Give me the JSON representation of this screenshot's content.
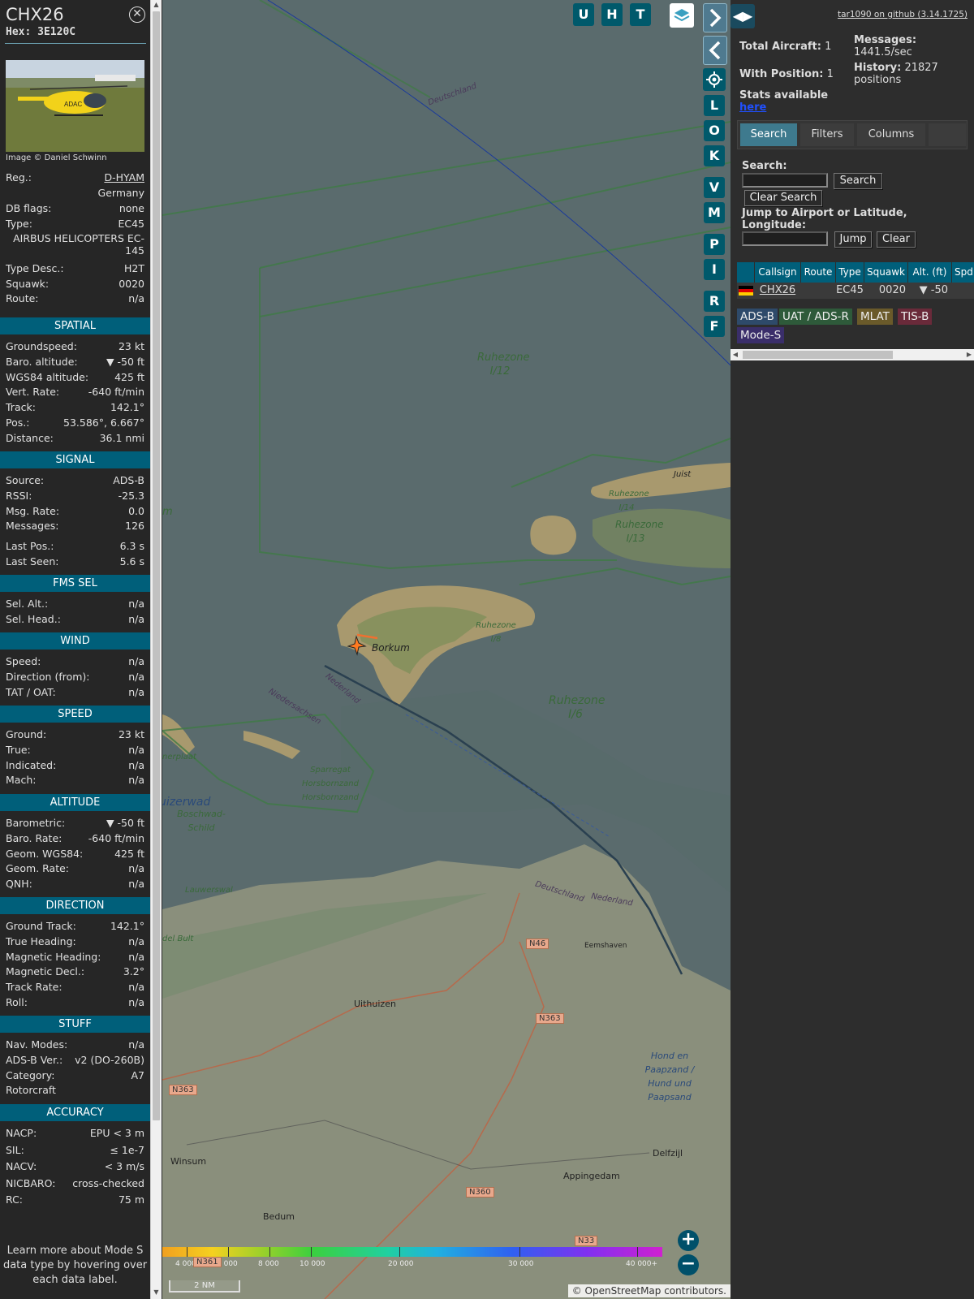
{
  "sidebar": {
    "callsign": "CHX26",
    "hex": "Hex: 3E120C",
    "photo_credit": "Image © Daniel Schwinn",
    "info_rows": [
      {
        "label": "Reg.:",
        "value": "D-HYAM"
      },
      {
        "label": "",
        "value": "Germany"
      },
      {
        "label": "DB flags:",
        "value": "none"
      },
      {
        "label": "Type:",
        "value": "EC45"
      },
      {
        "label": "",
        "value": "AIRBUS HELICOPTERS EC-145"
      },
      {
        "label": "Type Desc.:",
        "value": "H2T"
      },
      {
        "label": "Squawk:",
        "value": "0020"
      },
      {
        "label": "Route:",
        "value": "n/a"
      }
    ],
    "sections": [
      {
        "title": "SPATIAL",
        "rows": [
          {
            "label": "Groundspeed:",
            "value": "23 kt"
          },
          {
            "label": "Baro. altitude:",
            "value": "▼ -50 ft"
          },
          {
            "label": "WGS84 altitude:",
            "value": "425 ft"
          },
          {
            "label": "Vert. Rate:",
            "value": "-640 ft/min"
          },
          {
            "label": "Track:",
            "value": "142.1°"
          },
          {
            "label": "Pos.:",
            "value": "53.586°, 6.667°"
          },
          {
            "label": "Distance:",
            "value": "36.1 nmi"
          }
        ]
      },
      {
        "title": "SIGNAL",
        "rows": [
          {
            "label": "Source:",
            "value": "ADS-B"
          },
          {
            "label": "RSSI:",
            "value": "-25.3"
          },
          {
            "label": "Msg. Rate:",
            "value": "0.0"
          },
          {
            "label": "Messages:",
            "value": "126"
          },
          {
            "label": "Last Pos.:",
            "value": "6.3 s"
          },
          {
            "label": "Last Seen:",
            "value": "5.6 s"
          }
        ]
      },
      {
        "title": "FMS SEL",
        "rows": [
          {
            "label": "Sel. Alt.:",
            "value": "n/a"
          },
          {
            "label": "Sel. Head.:",
            "value": "n/a"
          }
        ]
      },
      {
        "title": "WIND",
        "rows": [
          {
            "label": "Speed:",
            "value": "n/a"
          },
          {
            "label": "Direction (from):",
            "value": "n/a"
          },
          {
            "label": "TAT / OAT:",
            "value": "n/a"
          }
        ]
      },
      {
        "title": "SPEED",
        "rows": [
          {
            "label": "Ground:",
            "value": "23 kt"
          },
          {
            "label": "True:",
            "value": "n/a"
          },
          {
            "label": "Indicated:",
            "value": "n/a"
          },
          {
            "label": "Mach:",
            "value": "n/a"
          }
        ]
      },
      {
        "title": "ALTITUDE",
        "rows": [
          {
            "label": "Barometric:",
            "value": "▼ -50 ft"
          },
          {
            "label": "Baro. Rate:",
            "value": "-640 ft/min"
          },
          {
            "label": "Geom. WGS84:",
            "value": "425 ft"
          },
          {
            "label": "Geom. Rate:",
            "value": "n/a"
          },
          {
            "label": "QNH:",
            "value": "n/a"
          }
        ]
      },
      {
        "title": "DIRECTION",
        "rows": [
          {
            "label": "Ground Track:",
            "value": "142.1°"
          },
          {
            "label": "True Heading:",
            "value": "n/a"
          },
          {
            "label": "Magnetic Heading:",
            "value": "n/a"
          },
          {
            "label": "Magnetic Decl.:",
            "value": "3.2°"
          },
          {
            "label": "Track Rate:",
            "value": "n/a"
          },
          {
            "label": "Roll:",
            "value": "n/a"
          }
        ]
      },
      {
        "title": "STUFF",
        "rows": [
          {
            "label": "Nav. Modes:",
            "value": "n/a"
          },
          {
            "label": "ADS-B Ver.:",
            "value": "v2 (DO-260B)"
          },
          {
            "label": "Category:",
            "value": "A7"
          },
          {
            "label": "Rotorcraft",
            "value": ""
          }
        ]
      },
      {
        "title": "ACCURACY",
        "rows": [
          {
            "label": "NACP:",
            "value": "EPU < 3 m"
          },
          {
            "label": "SIL:",
            "value": "≤ 1e-7"
          },
          {
            "label": "NACV:",
            "value": "< 3 m/s"
          },
          {
            "label": "NICBARO:",
            "value": "cross-checked"
          },
          {
            "label": "RC:",
            "value": "75 m"
          }
        ]
      }
    ],
    "footer": "Learn more about Mode S data type by hovering over each data label."
  },
  "map": {
    "layer_buttons": [
      "U",
      "H",
      "T"
    ],
    "side_buttons": [
      "L",
      "O",
      "K",
      "V",
      "M",
      "P",
      "I",
      "R",
      "F"
    ],
    "labels": {
      "deutschland1": "Deutschland",
      "ruhezone12": "Ruhezone I/12",
      "juist": "Juist",
      "ruhezone14": "Ruhezone I/14",
      "ruhezone13": "Ruhezone I/13",
      "ruhezone8": "Ruhezone I/8",
      "borkum": "Borkum",
      "ruhezone6": "Ruhezone I/6",
      "nederland1": "Nederland",
      "niedersachsen": "Niedersachsen",
      "sparregat": "Sparregat Horsbornzand Horsbornzand",
      "boschwad": "Boschwad-Schild",
      "uizerwad": "uizerwad",
      "lauwerswal": "Lauwerswal",
      "nerplaat": "nerplaat",
      "deutschland2": "Deutschland",
      "nederland2": "Nederland",
      "eemshaven": "Eemshaven",
      "uithuizen": "Uithuizen",
      "hond": "Hond en Paapzand / Hund und Paapsand",
      "delfzijl": "Delfzijl",
      "appingedam": "Appingedam",
      "winsum": "Winsum",
      "bedum": "Bedum",
      "m": "m",
      "delbult": "del Bult"
    },
    "roads": [
      "N46",
      "N363",
      "N363",
      "N360",
      "N33",
      "N361"
    ],
    "altitude_scale": [
      "4 000",
      "6 000",
      "8 000",
      "10 000",
      "20 000",
      "30 000",
      "40 000+"
    ],
    "scale_bar": "2 NM",
    "zoom_in": "+",
    "zoom_out": "−",
    "attribution": "© OpenStreetMap contributors."
  },
  "panel": {
    "github_link": "tar1090 on github (3.14.1725)",
    "total_aircraft_label": "Total Aircraft:",
    "total_aircraft": "1",
    "with_position_label": "With Position:",
    "with_position": "1",
    "messages_label": "Messages:",
    "messages_rate": "1441.5/sec",
    "history_label": "History:",
    "history_value": "21827",
    "history_unit": "positions",
    "stats_text": "Stats available",
    "stats_link": "here",
    "tabs": [
      "Search",
      "Filters",
      "Columns"
    ],
    "search_label": "Search:",
    "search_button": "Search",
    "clear_search_button": "Clear Search",
    "jump_label": "Jump to Airport or Latitude, Longitude:",
    "jump_button": "Jump",
    "clear_button": "Clear",
    "table": {
      "headers": [
        "Callsign",
        "Route",
        "Type",
        "Squawk",
        "Alt. (ft)",
        "Spd."
      ],
      "rows": [
        {
          "flag": "de",
          "callsign": "CHX26",
          "route": "",
          "type": "EC45",
          "squawk": "0020",
          "alt": "▼ -50"
        }
      ]
    },
    "legend": [
      {
        "label": "ADS-B",
        "color": "#2e4a6a"
      },
      {
        "label": "UAT / ADS-R",
        "color": "#2e5a3a"
      },
      {
        "label": "MLAT",
        "color": "#6a5a2a"
      },
      {
        "label": "TIS-B",
        "color": "#6a2a3a"
      },
      {
        "label": "Mode-S",
        "color": "#3a2e6a"
      }
    ]
  }
}
